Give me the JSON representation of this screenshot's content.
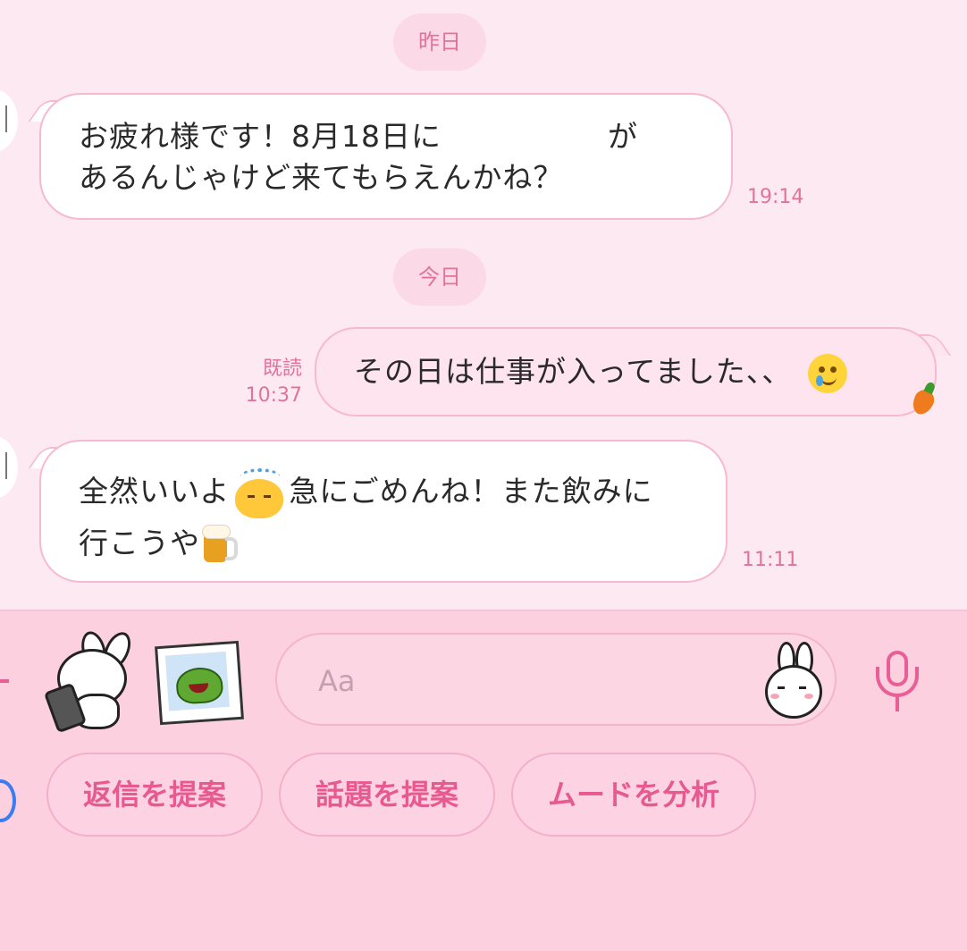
{
  "chat": {
    "date_yesterday": "昨日",
    "date_today": "今日",
    "messages": [
      {
        "line1": "お疲れ様です！8月18日に",
        "line1_tail": "が",
        "line2": "あるんじゃけど来てもらえんかね？",
        "time": "19:14"
      },
      {
        "text": "その日は仕事が入ってました、、",
        "read_label": "既読",
        "time": "10:37",
        "emoji": "crying-smile-emoji",
        "sticker_tag": "carrot-icon"
      },
      {
        "line1_a": "全然いいよ",
        "line1_b": "急にごめんね！また飲みに",
        "line2": "行こうや",
        "time": "11:11",
        "emojis": [
          "sweating-chick-emoji",
          "beer-emoji"
        ]
      }
    ]
  },
  "composer": {
    "input_placeholder": "Aa",
    "suggestions": [
      "返信を提案",
      "話題を提案",
      "ムードを分析"
    ]
  },
  "colors": {
    "accent": "#ea5e96",
    "chat_bg": "#fde9f1",
    "composer_bg": "#fdd0e0",
    "bubble_border": "#f6b9cf"
  }
}
